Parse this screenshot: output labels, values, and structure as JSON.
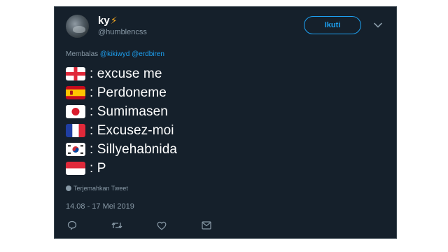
{
  "tweet": {
    "display_name": "ky",
    "name_emoji": "⚡",
    "handle": "@humblencss",
    "follow_label": "Ikuti",
    "reply_prefix": "Membalas",
    "reply_mentions": [
      "@kikiwyd",
      "@erdbiren"
    ],
    "lines": [
      {
        "flag": "england-flag",
        "text": ": excuse me"
      },
      {
        "flag": "spain-flag",
        "text": ": Perdoneme"
      },
      {
        "flag": "japan-flag",
        "text": ": Sumimasen"
      },
      {
        "flag": "france-flag",
        "text": ": Excusez-moi"
      },
      {
        "flag": "south-korea-flag",
        "text": ": Sillyehabnida"
      },
      {
        "flag": "indonesia-flag",
        "text": ": P"
      }
    ],
    "translate_label": "Terjemahkan Tweet",
    "timestamp": "14.08 - 17 Mei 2019",
    "actions": [
      "reply-icon",
      "retweet-icon",
      "like-icon",
      "message-icon"
    ]
  },
  "colors": {
    "background": "#15202b",
    "accent": "#1da1f2",
    "muted": "#8899a6",
    "bolt": "#ffad1f"
  }
}
